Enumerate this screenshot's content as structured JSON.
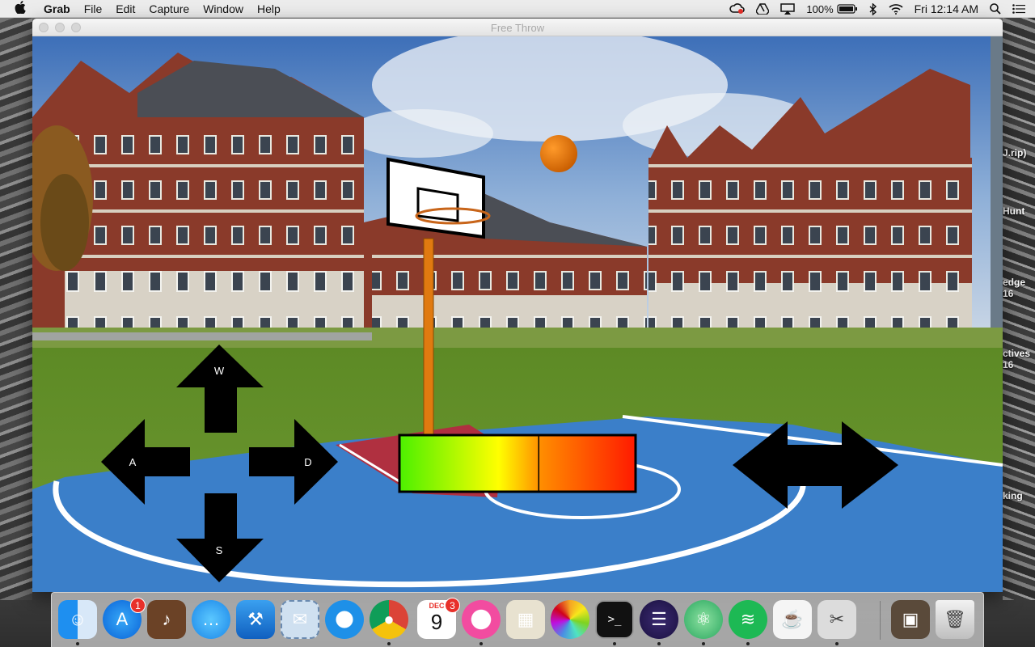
{
  "menubar": {
    "app_name": "Grab",
    "items": [
      "File",
      "Edit",
      "Capture",
      "Window",
      "Help"
    ],
    "battery": "100%",
    "clock": "Fri 12:14 AM"
  },
  "window": {
    "title": "Free Throw"
  },
  "game": {
    "controls": {
      "up_key": "W",
      "left_key": "A",
      "right_key": "D",
      "down_key": "S"
    },
    "power_meter": {
      "gradient": [
        "#4cf000",
        "#ffff00",
        "#ff8c00",
        "#ff1a00"
      ],
      "divider_at": 0.59
    },
    "colors": {
      "ball": "#e07000",
      "court": "#3b7fc9",
      "key_paint": "#b03040",
      "pole": "#e07a10"
    }
  },
  "desktop": {
    "labels": [
      "J.rip)",
      "Hunt",
      "edge\n16",
      "ctives\n16",
      "king"
    ]
  },
  "dock": {
    "items": [
      {
        "name": "finder-icon",
        "badge": ""
      },
      {
        "name": "app-store-icon",
        "badge": "1"
      },
      {
        "name": "garageband-icon",
        "badge": ""
      },
      {
        "name": "messages-icon",
        "badge": ""
      },
      {
        "name": "xcode-icon",
        "badge": ""
      },
      {
        "name": "mail-stamp-icon",
        "badge": ""
      },
      {
        "name": "safari-icon",
        "badge": ""
      },
      {
        "name": "chrome-icon",
        "badge": ""
      },
      {
        "name": "calendar-icon",
        "badge": "3",
        "month": "DEC",
        "day": "9"
      },
      {
        "name": "itunes-icon",
        "badge": ""
      },
      {
        "name": "preview-icon",
        "badge": ""
      },
      {
        "name": "photos-icon",
        "badge": ""
      },
      {
        "name": "terminal-icon",
        "badge": ""
      },
      {
        "name": "eclipse-icon",
        "badge": ""
      },
      {
        "name": "atom-icon",
        "badge": ""
      },
      {
        "name": "spotify-icon",
        "badge": ""
      },
      {
        "name": "java-icon",
        "badge": ""
      },
      {
        "name": "grab-scissors-icon",
        "badge": ""
      },
      {
        "name": "downloads-folder-icon",
        "badge": ""
      },
      {
        "name": "trash-icon",
        "badge": ""
      }
    ]
  }
}
